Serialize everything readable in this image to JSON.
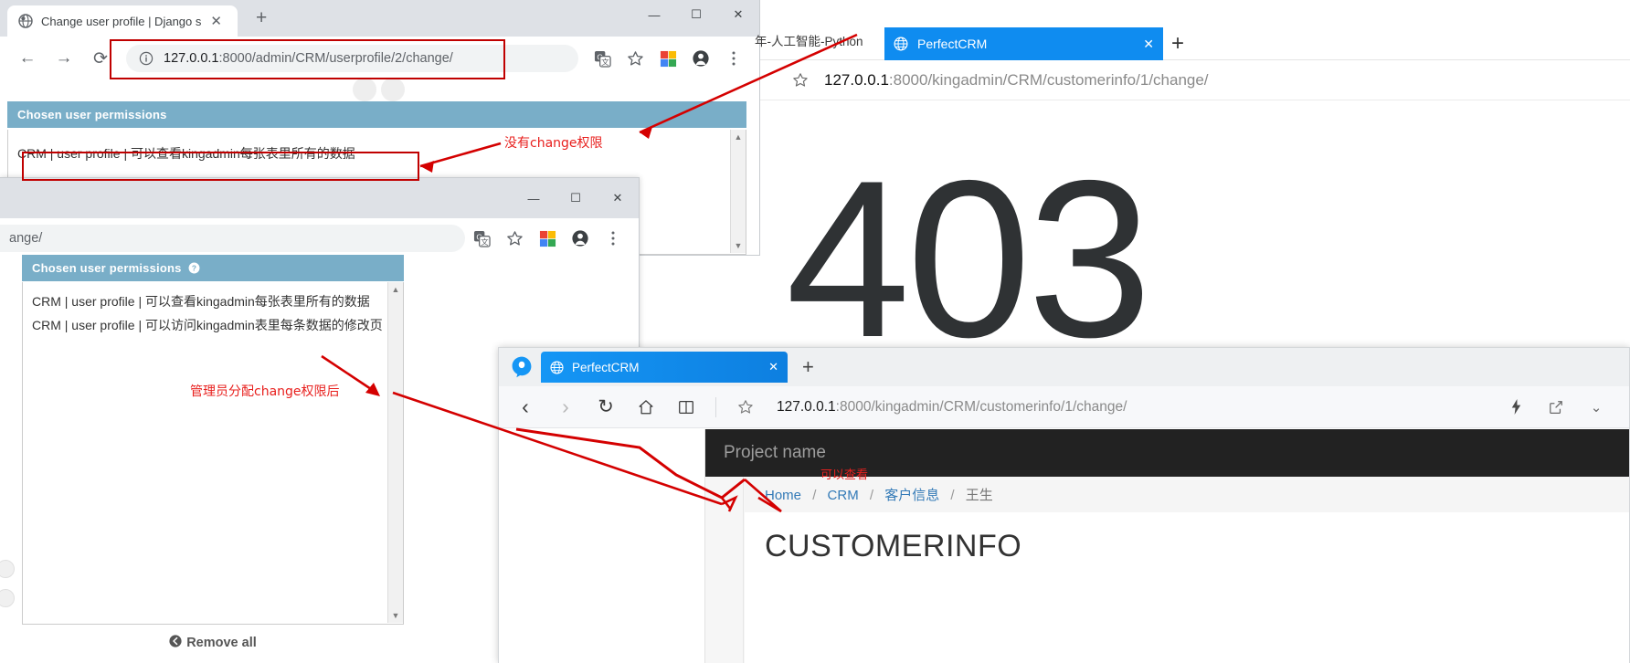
{
  "window_chrome_admin": {
    "tab": {
      "title": "Change user profile | Django s",
      "favicon": "globe-icon",
      "close": "✕"
    },
    "new_tab_label": "+",
    "window_controls": {
      "minimize": "—",
      "maximize": "☐",
      "close": "✕"
    },
    "nav": {
      "back": "←",
      "forward": "→",
      "reload": "⟳"
    },
    "omnibox": {
      "info_icon": "info-circle-icon",
      "url_scheme": "127.0.0.1",
      "url_rest": ":8000/admin/CRM/userprofile/2/change/"
    },
    "toolbar_icons": [
      "translate-icon",
      "bookmark-star-icon",
      "extension-icon",
      "profile-icon",
      "menu-kebab-icon"
    ],
    "selector": {
      "header": "Chosen user permissions",
      "items": [
        "CRM | user profile | 可以查看kingadmin每张表里所有的数据"
      ]
    }
  },
  "window_chrome_admin2": {
    "window_controls": {
      "minimize": "—",
      "maximize": "☐",
      "close": "✕"
    },
    "omnibox": {
      "url_tail": "ange/"
    },
    "toolbar_icons": [
      "translate-icon",
      "bookmark-star-icon",
      "extension-icon",
      "profile-icon",
      "menu-kebab-icon"
    ],
    "selector": {
      "header": "Chosen user permissions",
      "help_icon": "question-mark-icon",
      "items": [
        "CRM | user profile | 可以查看kingadmin每张表里所有的数据",
        "CRM | user profile | 可以访问kingadmin表里每条数据的修改页"
      ]
    },
    "remove_all": {
      "icon": "circle-left-arrow-icon",
      "label": "Remove all"
    }
  },
  "window_ie_403": {
    "partial_tab_title": "年-人工智能-Python",
    "tab": {
      "title": "PerfectCRM",
      "favicon": "globe-icon",
      "close": "✕"
    },
    "new_tab_label": "+",
    "star_icon": "bookmark-star-icon",
    "url_scheme": "127.0.0.1",
    "url_rest": ":8000/kingadmin/CRM/customerinfo/1/change/",
    "error_code": "403"
  },
  "window_qq_crm": {
    "browser_logo": "qq-browser-logo-icon",
    "tab": {
      "title": "PerfectCRM",
      "favicon": "globe-icon",
      "close": "✕"
    },
    "new_tab_label": "+",
    "nav": {
      "back": "‹",
      "forward": "›",
      "reload": "↻",
      "home": "⌂",
      "reader": "□"
    },
    "star_icon": "bookmark-star-icon",
    "url_scheme": "127.0.0.1",
    "url_rest": ":8000/kingadmin/CRM/customerinfo/1/change/",
    "right_icons": [
      "lightning-icon",
      "share-icon",
      "chevron-down-icon"
    ],
    "navbar_brand": "Project name",
    "breadcrumb": [
      {
        "label": "Home",
        "active": false
      },
      {
        "label": "CRM",
        "active": false
      },
      {
        "label": "客户信息",
        "active": false
      },
      {
        "label": "王生",
        "active": true
      }
    ],
    "breadcrumb_separator": "/",
    "page_title": "CUSTOMERINFO"
  },
  "annotations": [
    {
      "id": "no-change-perm",
      "text": "没有change权限"
    },
    {
      "id": "after-admin-assigns",
      "text": "管理员分配change权限后"
    },
    {
      "id": "can-view",
      "text": "可以查看"
    }
  ],
  "colors": {
    "django_header_blue": "#79aec8",
    "annotation_red": "#e8201e",
    "box_outline_red": "#c00000",
    "navbar_dark": "#222222",
    "breadcrumb_link": "#337ab7",
    "qq_tab_blue": "#1596f5"
  }
}
